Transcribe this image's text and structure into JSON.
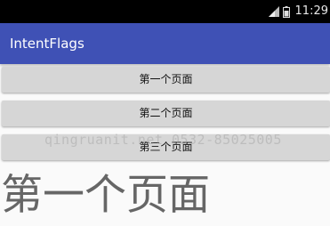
{
  "status_bar": {
    "time": "11:29",
    "icons": [
      "signal-icon",
      "battery-icon"
    ]
  },
  "app_bar": {
    "title": "IntentFlags",
    "color": "#3f51b5"
  },
  "buttons": [
    {
      "label": "第一个页面"
    },
    {
      "label": "第二个页面"
    },
    {
      "label": "第三个页面"
    }
  ],
  "content": {
    "heading": "第一个页面"
  },
  "watermark": {
    "text": "qingruanit.net 0532-85025005"
  }
}
